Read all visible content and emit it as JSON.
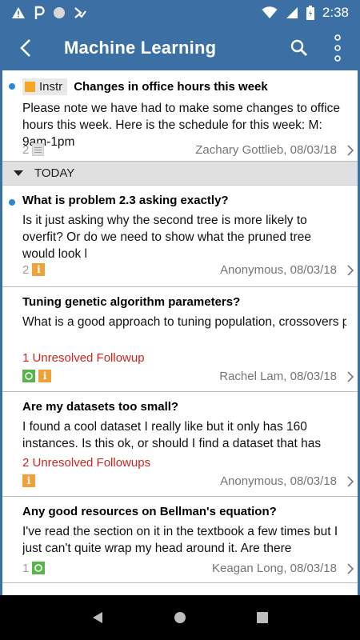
{
  "status_bar": {
    "time": "2:38"
  },
  "app_bar": {
    "title": "Machine Learning"
  },
  "pinned_post": {
    "instr_label": "Instr",
    "title": "Changes in office hours this week",
    "body": "Please note we have had to make some changes to office hours this week. Here is the schedule for this week: M: 9am-1pm",
    "count": "2",
    "meta": "Zachary Gottlieb, 08/03/18"
  },
  "section": {
    "label": "TODAY"
  },
  "posts": [
    {
      "title": "What is problem 2.3 asking exactly?",
      "body": "Is it just asking why the second tree is more likely to overfit? Or do we need to show what the pruned tree would look l",
      "count": "2",
      "followup": "",
      "meta": "Anonymous, 08/03/18"
    },
    {
      "title": "Tuning genetic algorithm parameters?",
      "body": "What is a good approach to tuning population, crossovers per iterations, and mutations per iteration, etc. Is there a ru",
      "count": "",
      "followup": "1 Unresolved Followup",
      "meta": "Rachel Lam, 08/03/18"
    },
    {
      "title": "Are my datasets too small?",
      "body": "I found a cool dataset I really like but it only has 160 instances. Is this ok, or should I find a dataset that has more",
      "count": "",
      "followup": "2 Unresolved Followups",
      "meta": "Anonymous, 08/03/18"
    },
    {
      "title": "Any good resources on Bellman's equation?",
      "body": "I've read the section on it in the textbook a few times but I just can't quite wrap my head around it. Are there",
      "count": "1",
      "followup": "",
      "meta": "Keagan Long, 08/03/18"
    }
  ],
  "colors": {
    "app_bar": "#3c70a4",
    "unread_dot": "#2d89d6",
    "followup_red": "#d0251e",
    "instr_orange": "#f5a623",
    "student_green": "#59b44a"
  },
  "icons": [
    "warning-icon",
    "p-icon",
    "circle-icon",
    "download-check-icon",
    "wifi-icon",
    "signal-icon",
    "battery-icon",
    "back-arrow-icon",
    "search-icon",
    "more-vert-icon",
    "doc-icon",
    "instructor-icon",
    "student-icon",
    "chevron-right-icon",
    "triangle-down-icon",
    "nav-back-icon",
    "nav-home-icon",
    "nav-recents-icon"
  ]
}
